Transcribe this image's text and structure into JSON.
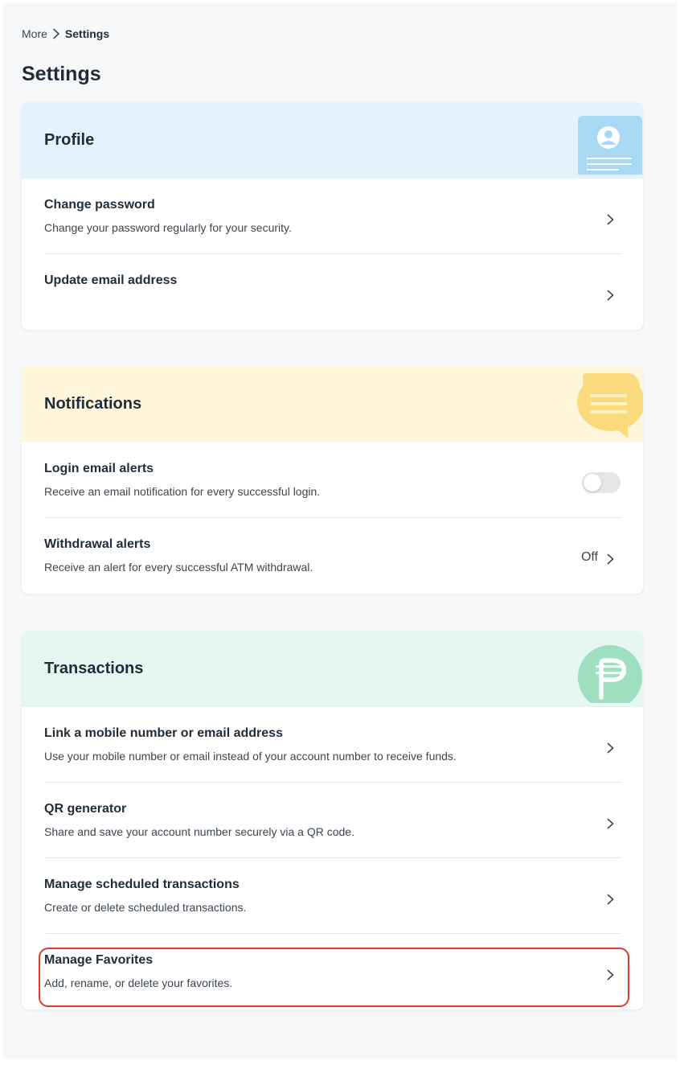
{
  "breadcrumb": {
    "parent": "More",
    "current": "Settings"
  },
  "page": {
    "title": "Settings"
  },
  "colors": {
    "profile_header": "#e3f2fb",
    "notifications_header": "#fff6dc",
    "transactions_header": "#e6f6f0",
    "highlight": "#e03c2a"
  },
  "profile": {
    "title": "Profile",
    "icon": "profile-card-icon",
    "items": [
      {
        "title": "Change password",
        "description": "Change your password regularly for your security."
      },
      {
        "title": "Update email address"
      }
    ]
  },
  "notifications": {
    "title": "Notifications",
    "icon": "chat-bubble-icon",
    "items": [
      {
        "title": "Login email alerts",
        "description": "Receive an email notification for every successful login.",
        "toggle_on": false
      },
      {
        "title": "Withdrawal alerts",
        "description": "Receive an alert for every successful ATM withdrawal.",
        "value": "Off"
      }
    ]
  },
  "transactions": {
    "title": "Transactions",
    "icon": "peso-coin-icon",
    "items": [
      {
        "title": "Link a mobile number or email address",
        "description": "Use your mobile number or email instead of your account number to receive funds."
      },
      {
        "title": "QR generator",
        "description": "Share and save your account number securely via a QR code."
      },
      {
        "title": "Manage scheduled transactions",
        "description": "Create or delete scheduled transactions."
      },
      {
        "title": "Manage Favorites",
        "description": "Add, rename, or delete your favorites.",
        "highlighted": true
      }
    ]
  }
}
